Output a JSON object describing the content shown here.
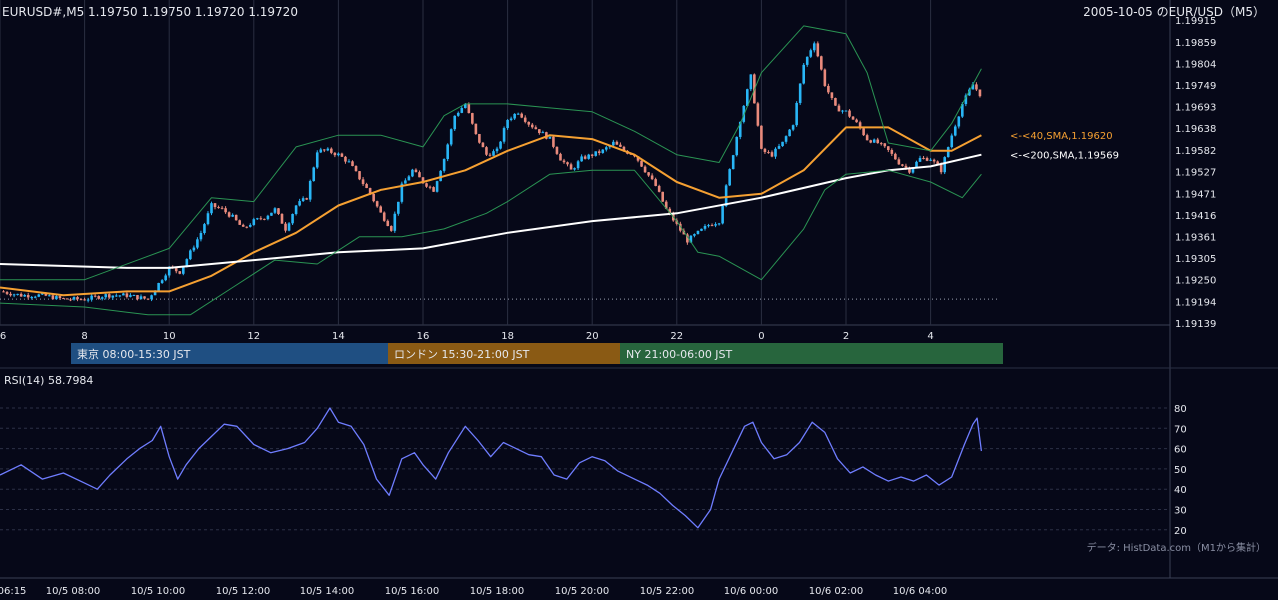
{
  "header": {
    "symbol_ohlc": "EURUSD#,M5 1.19750 1.19750 1.19720 1.19720",
    "date_title": "2005-10-05 のEUR/USD（M5）"
  },
  "chart_data": [
    {
      "type": "candlestick",
      "title": "2005-10-05 のEUR/USD（M5）",
      "subtitle": "EURUSD#,M5 1.19750 1.19750 1.19720 1.19720",
      "ylim": [
        1.19139,
        1.19915
      ],
      "ytick_labels": [
        "1.19915",
        "1.19859",
        "1.19804",
        "1.19749",
        "1.19693",
        "1.19638",
        "1.19582",
        "1.19527",
        "1.19471",
        "1.19416",
        "1.19361",
        "1.19305",
        "1.19250",
        "1.19194",
        "1.19139"
      ],
      "xtick_labels": [
        "6",
        "8",
        "10",
        "12",
        "14",
        "16",
        "18",
        "20",
        "22",
        "0",
        "2",
        "4"
      ],
      "x_hours": [
        6,
        8,
        10,
        12,
        14,
        16,
        18,
        20,
        22,
        24,
        26,
        28
      ],
      "x_range_hours": [
        6.0,
        29.2
      ],
      "grid": true,
      "close_path": [
        [
          6.0,
          1.1922
        ],
        [
          6.5,
          1.1921
        ],
        [
          7.0,
          1.1921
        ],
        [
          7.5,
          1.192
        ],
        [
          8.0,
          1.192
        ],
        [
          8.5,
          1.1921
        ],
        [
          9.0,
          1.1921
        ],
        [
          9.5,
          1.192
        ],
        [
          9.75,
          1.1924
        ],
        [
          10.0,
          1.1928
        ],
        [
          10.25,
          1.1927
        ],
        [
          10.5,
          1.1932
        ],
        [
          10.75,
          1.1937
        ],
        [
          11.0,
          1.1944
        ],
        [
          11.25,
          1.1943
        ],
        [
          11.5,
          1.1941
        ],
        [
          11.75,
          1.1938
        ],
        [
          12.0,
          1.194
        ],
        [
          12.25,
          1.1941
        ],
        [
          12.5,
          1.1943
        ],
        [
          12.75,
          1.1938
        ],
        [
          13.0,
          1.1944
        ],
        [
          13.25,
          1.1946
        ],
        [
          13.5,
          1.1958
        ],
        [
          13.75,
          1.1958
        ],
        [
          14.0,
          1.1957
        ],
        [
          14.25,
          1.1955
        ],
        [
          14.5,
          1.1951
        ],
        [
          14.75,
          1.1947
        ],
        [
          15.0,
          1.1942
        ],
        [
          15.25,
          1.1938
        ],
        [
          15.5,
          1.1949
        ],
        [
          15.75,
          1.1953
        ],
        [
          16.0,
          1.195
        ],
        [
          16.25,
          1.1948
        ],
        [
          16.5,
          1.1956
        ],
        [
          16.75,
          1.1967
        ],
        [
          17.0,
          1.197
        ],
        [
          17.25,
          1.1962
        ],
        [
          17.5,
          1.1957
        ],
        [
          17.75,
          1.1958
        ],
        [
          18.0,
          1.1966
        ],
        [
          18.25,
          1.1968
        ],
        [
          18.5,
          1.1965
        ],
        [
          18.75,
          1.1963
        ],
        [
          19.0,
          1.1961
        ],
        [
          19.25,
          1.1956
        ],
        [
          19.5,
          1.1953
        ],
        [
          19.75,
          1.1956
        ],
        [
          20.0,
          1.1957
        ],
        [
          20.25,
          1.1958
        ],
        [
          20.5,
          1.196
        ],
        [
          20.75,
          1.1958
        ],
        [
          21.0,
          1.1957
        ],
        [
          21.25,
          1.1953
        ],
        [
          21.5,
          1.1949
        ],
        [
          21.75,
          1.1943
        ],
        [
          22.0,
          1.1939
        ],
        [
          22.25,
          1.1935
        ],
        [
          22.5,
          1.1937
        ],
        [
          22.75,
          1.1939
        ],
        [
          23.0,
          1.194
        ],
        [
          23.25,
          1.1953
        ],
        [
          23.5,
          1.1966
        ],
        [
          23.75,
          1.1977
        ],
        [
          24.0,
          1.1958
        ],
        [
          24.25,
          1.1957
        ],
        [
          24.5,
          1.196
        ],
        [
          24.75,
          1.1965
        ],
        [
          25.0,
          1.198
        ],
        [
          25.25,
          1.1986
        ],
        [
          25.5,
          1.1975
        ],
        [
          25.75,
          1.1969
        ],
        [
          26.0,
          1.1968
        ],
        [
          26.25,
          1.1965
        ],
        [
          26.5,
          1.1961
        ],
        [
          26.75,
          1.196
        ],
        [
          27.0,
          1.1958
        ],
        [
          27.25,
          1.1955
        ],
        [
          27.5,
          1.1953
        ],
        [
          27.75,
          1.1956
        ],
        [
          28.0,
          1.1956
        ],
        [
          28.25,
          1.1953
        ],
        [
          28.5,
          1.1962
        ],
        [
          28.75,
          1.197
        ],
        [
          29.0,
          1.1975
        ],
        [
          29.2,
          1.1972
        ]
      ],
      "series": [
        {
          "name": "<-<40,SMA,1.19620",
          "color": "#f5a032",
          "points": [
            [
              6.0,
              1.1923
            ],
            [
              7.5,
              1.1921
            ],
            [
              9.0,
              1.1922
            ],
            [
              10.0,
              1.1922
            ],
            [
              11.0,
              1.1926
            ],
            [
              12.0,
              1.1932
            ],
            [
              13.0,
              1.1937
            ],
            [
              14.0,
              1.1944
            ],
            [
              15.0,
              1.1948
            ],
            [
              16.0,
              1.195
            ],
            [
              17.0,
              1.1953
            ],
            [
              18.0,
              1.1958
            ],
            [
              19.0,
              1.1962
            ],
            [
              20.0,
              1.1961
            ],
            [
              21.0,
              1.1957
            ],
            [
              22.0,
              1.195
            ],
            [
              23.0,
              1.1946
            ],
            [
              24.0,
              1.1947
            ],
            [
              25.0,
              1.1953
            ],
            [
              26.0,
              1.1964
            ],
            [
              27.0,
              1.1964
            ],
            [
              28.0,
              1.1958
            ],
            [
              28.5,
              1.1958
            ],
            [
              29.2,
              1.1962
            ]
          ]
        },
        {
          "name": "<-<200,SMA,1.19569",
          "color": "#ffffff",
          "points": [
            [
              6.0,
              1.1929
            ],
            [
              9.0,
              1.1928
            ],
            [
              10.0,
              1.1928
            ],
            [
              12.0,
              1.193
            ],
            [
              14.0,
              1.1932
            ],
            [
              16.0,
              1.1933
            ],
            [
              18.0,
              1.1937
            ],
            [
              20.0,
              1.194
            ],
            [
              22.0,
              1.1942
            ],
            [
              24.0,
              1.1946
            ],
            [
              26.0,
              1.1951
            ],
            [
              27.0,
              1.1953
            ],
            [
              28.0,
              1.1954
            ],
            [
              29.2,
              1.1957
            ]
          ]
        },
        {
          "name": "BB upper",
          "color": "#2fa35a",
          "points": [
            [
              6.0,
              1.1925
            ],
            [
              8.0,
              1.1925
            ],
            [
              10.0,
              1.1933
            ],
            [
              11.0,
              1.1946
            ],
            [
              12.0,
              1.1945
            ],
            [
              13.0,
              1.1959
            ],
            [
              14.0,
              1.1962
            ],
            [
              15.0,
              1.1962
            ],
            [
              16.0,
              1.1959
            ],
            [
              16.5,
              1.1967
            ],
            [
              17.0,
              1.197
            ],
            [
              18.0,
              1.197
            ],
            [
              19.0,
              1.1969
            ],
            [
              20.0,
              1.1968
            ],
            [
              21.0,
              1.1963
            ],
            [
              22.0,
              1.1957
            ],
            [
              23.0,
              1.1955
            ],
            [
              23.5,
              1.1965
            ],
            [
              24.0,
              1.1978
            ],
            [
              25.0,
              1.199
            ],
            [
              26.0,
              1.1988
            ],
            [
              26.5,
              1.1978
            ],
            [
              27.0,
              1.196
            ],
            [
              28.0,
              1.1958
            ],
            [
              28.5,
              1.1965
            ],
            [
              29.2,
              1.1979
            ]
          ]
        },
        {
          "name": "BB lower",
          "color": "#2fa35a",
          "points": [
            [
              6.0,
              1.1919
            ],
            [
              8.0,
              1.1918
            ],
            [
              9.5,
              1.1916
            ],
            [
              10.5,
              1.1916
            ],
            [
              11.5,
              1.1923
            ],
            [
              12.5,
              1.193
            ],
            [
              13.5,
              1.1929
            ],
            [
              14.5,
              1.1936
            ],
            [
              15.5,
              1.1936
            ],
            [
              16.5,
              1.1938
            ],
            [
              17.5,
              1.1942
            ],
            [
              18.0,
              1.1945
            ],
            [
              19.0,
              1.1952
            ],
            [
              20.0,
              1.1953
            ],
            [
              21.0,
              1.1953
            ],
            [
              22.0,
              1.194
            ],
            [
              22.5,
              1.1932
            ],
            [
              23.0,
              1.1931
            ],
            [
              24.0,
              1.1925
            ],
            [
              25.0,
              1.1938
            ],
            [
              25.5,
              1.1948
            ],
            [
              26.0,
              1.1952
            ],
            [
              27.0,
              1.1953
            ],
            [
              28.0,
              1.195
            ],
            [
              28.75,
              1.1946
            ],
            [
              29.2,
              1.1952
            ]
          ]
        }
      ],
      "dotted_level": 1.192,
      "annotations": {
        "sma40_label": "<-<40,SMA,1.19620",
        "sma200_label": "<-<200,SMA,1.19569"
      }
    },
    {
      "type": "line",
      "title": "RSI(14) 58.7984",
      "ylim": [
        15,
        85
      ],
      "ytick_labels": [
        "80",
        "70",
        "60",
        "50",
        "40",
        "30",
        "20"
      ],
      "y_values": [
        80,
        70,
        60,
        50,
        40,
        30,
        20
      ],
      "x_range_hours": [
        6.0,
        29.2
      ],
      "series": [
        {
          "name": "RSI(14)",
          "color": "#6f7dff",
          "points": [
            [
              6.0,
              47
            ],
            [
              6.5,
              52
            ],
            [
              7.0,
              45
            ],
            [
              7.5,
              48
            ],
            [
              8.0,
              43
            ],
            [
              8.3,
              40
            ],
            [
              8.6,
              47
            ],
            [
              9.0,
              55
            ],
            [
              9.3,
              60
            ],
            [
              9.6,
              64
            ],
            [
              9.8,
              71
            ],
            [
              10.0,
              56
            ],
            [
              10.2,
              45
            ],
            [
              10.4,
              52
            ],
            [
              10.7,
              60
            ],
            [
              11.0,
              66
            ],
            [
              11.3,
              72
            ],
            [
              11.6,
              71
            ],
            [
              12.0,
              62
            ],
            [
              12.4,
              58
            ],
            [
              12.8,
              60
            ],
            [
              13.2,
              63
            ],
            [
              13.5,
              70
            ],
            [
              13.8,
              80
            ],
            [
              14.0,
              73
            ],
            [
              14.3,
              71
            ],
            [
              14.6,
              62
            ],
            [
              14.9,
              45
            ],
            [
              15.2,
              37
            ],
            [
              15.5,
              55
            ],
            [
              15.8,
              58
            ],
            [
              16.0,
              52
            ],
            [
              16.3,
              45
            ],
            [
              16.6,
              58
            ],
            [
              17.0,
              71
            ],
            [
              17.3,
              64
            ],
            [
              17.6,
              56
            ],
            [
              17.9,
              63
            ],
            [
              18.2,
              60
            ],
            [
              18.5,
              57
            ],
            [
              18.8,
              56
            ],
            [
              19.1,
              47
            ],
            [
              19.4,
              45
            ],
            [
              19.7,
              53
            ],
            [
              20.0,
              56
            ],
            [
              20.3,
              54
            ],
            [
              20.6,
              49
            ],
            [
              21.0,
              45
            ],
            [
              21.3,
              42
            ],
            [
              21.6,
              38
            ],
            [
              21.9,
              32
            ],
            [
              22.2,
              27
            ],
            [
              22.5,
              21
            ],
            [
              22.8,
              30
            ],
            [
              23.0,
              45
            ],
            [
              23.3,
              58
            ],
            [
              23.6,
              71
            ],
            [
              23.8,
              73
            ],
            [
              24.0,
              63
            ],
            [
              24.3,
              55
            ],
            [
              24.6,
              57
            ],
            [
              24.9,
              63
            ],
            [
              25.2,
              73
            ],
            [
              25.5,
              68
            ],
            [
              25.8,
              55
            ],
            [
              26.1,
              48
            ],
            [
              26.4,
              51
            ],
            [
              26.7,
              47
            ],
            [
              27.0,
              44
            ],
            [
              27.3,
              46
            ],
            [
              27.6,
              44
            ],
            [
              27.9,
              47
            ],
            [
              28.2,
              42
            ],
            [
              28.5,
              46
            ],
            [
              28.8,
              62
            ],
            [
              29.0,
              72
            ],
            [
              29.1,
              75
            ],
            [
              29.2,
              58.8
            ]
          ]
        }
      ]
    }
  ],
  "sessions": [
    {
      "label": "東京 08:00-15:30 JST",
      "color": "#1f4f82"
    },
    {
      "label": "ロンドン 15:30-21:00 JST",
      "color": "#8a5a14"
    },
    {
      "label": "NY 21:00-06:00 JST",
      "color": "#27653d"
    }
  ],
  "rsi_title": "RSI(14) 58.7984",
  "source_note": "データ: HistData.com（M1から集計）",
  "time_axis": [
    "06:15",
    "10/5 08:00",
    "10/5 10:00",
    "10/5 12:00",
    "10/5 14:00",
    "10/5 16:00",
    "10/5 18:00",
    "10/5 20:00",
    "10/5 22:00",
    "10/6 00:00",
    "10/6 02:00",
    "10/6 04:00"
  ]
}
